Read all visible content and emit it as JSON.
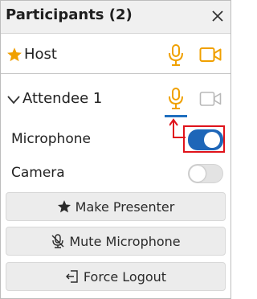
{
  "header": {
    "title": "Participants (2)",
    "close_icon": "close-icon"
  },
  "host": {
    "name": "Host",
    "icon": "star-icon",
    "mic_icon": "microphone-icon",
    "camera_icon": "video-camera-icon"
  },
  "attendee": {
    "name": "Attendee 1",
    "expand_icon": "chevron-down-icon",
    "mic_icon": "microphone-icon",
    "camera_icon": "video-camera-icon",
    "camera_enabled": false
  },
  "toggles": {
    "microphone": {
      "label": "Microphone",
      "on": true
    },
    "camera": {
      "label": "Camera",
      "on": false
    }
  },
  "actions": {
    "make_presenter": "Make Presenter",
    "mute_microphone": "Mute Microphone",
    "force_logout": "Force Logout"
  },
  "colors": {
    "accent_orange": "#f0a000",
    "toggle_on": "#1e66b8",
    "annotation_red": "#e0131b",
    "disabled_gray": "#b8b8b8"
  }
}
